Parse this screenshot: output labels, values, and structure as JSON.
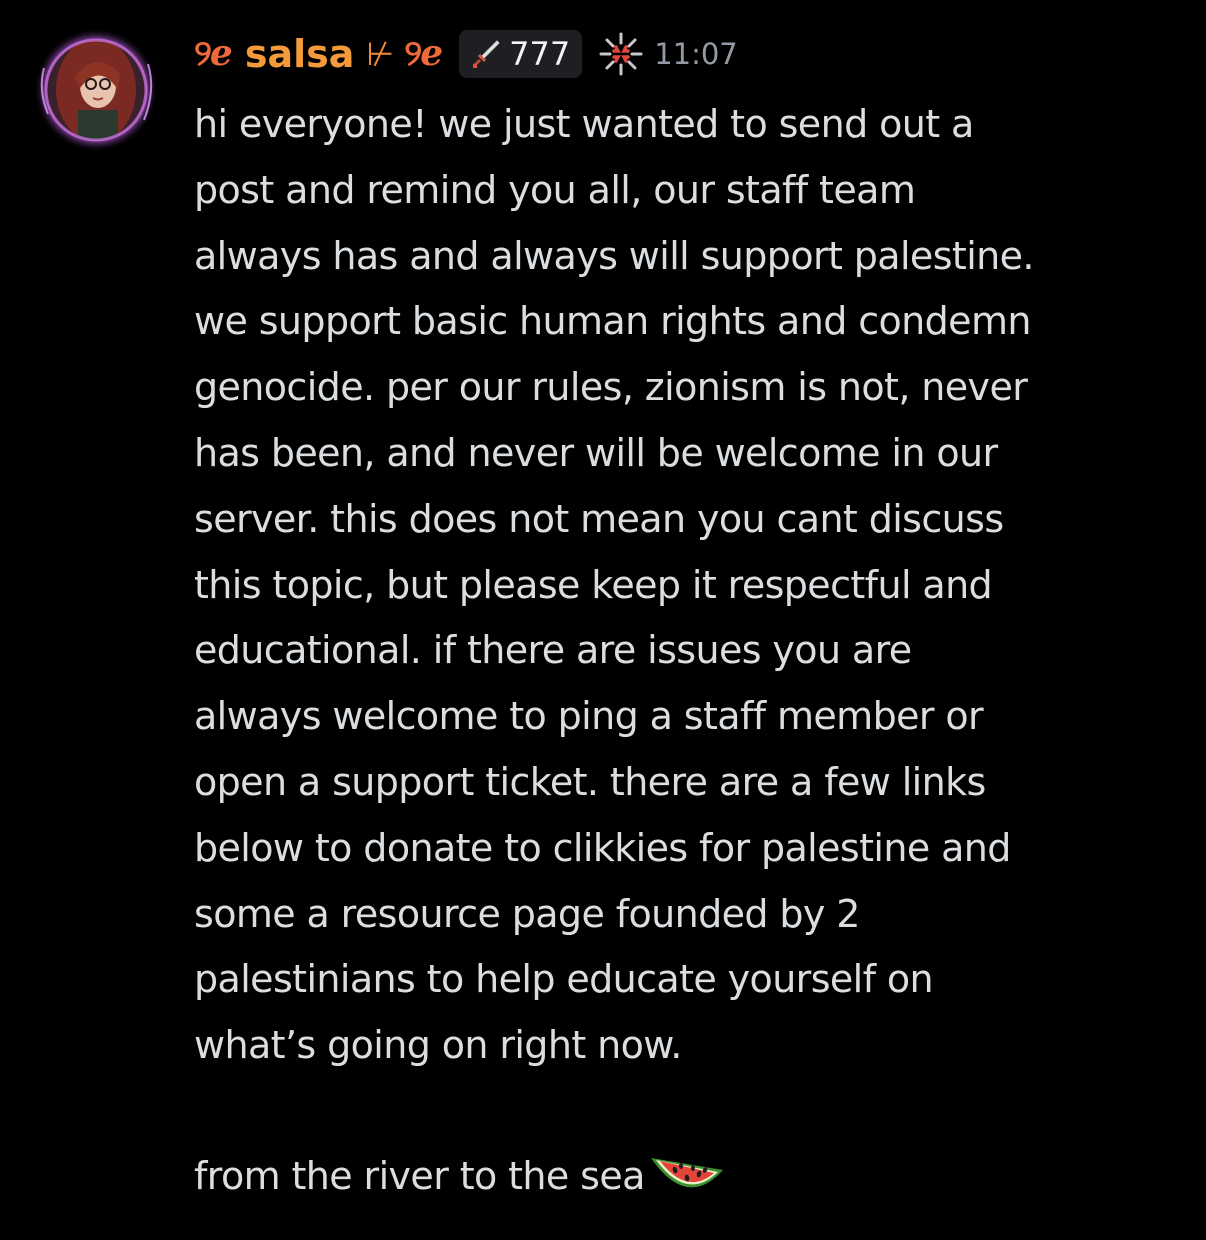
{
  "message": {
    "author": {
      "prefix_glyph": "୨ℯ",
      "name": "salsa",
      "separator": "⊬",
      "suffix_glyph": "୨ℯ",
      "name_color": "#f59a3a",
      "glyph_color": "#ee6a3b"
    },
    "guild_tag": {
      "icon": "sword-icon",
      "label": "777"
    },
    "role_icon": "anger-sparkle-icon",
    "timestamp": "11:07",
    "body": "hi everyone! we just wanted to send out a\npost and remind you all, our staff team\nalways has and always will support palestine.\nwe support basic human rights and condemn\ngenocide. per our rules, zionism is not, never\nhas been, and never will be welcome in our\nserver. this does not mean you cant discuss\nthis topic, but please keep it respectful and\neducational. if there are issues you are\nalways welcome to ping a staff member or\nopen a support ticket. there are a few links\nbelow to donate to clikkies for palestine and\nsome a resource page founded by 2\npalestinians to help educate yourself on\nwhat’s going on right now.",
    "closing_line": "from the river to the sea",
    "closing_emoji": "watermelon-icon"
  },
  "theme": {
    "background": "#000000",
    "text": "#dbdee1",
    "muted": "#949ba4",
    "tag_background": "#1e1f22"
  }
}
